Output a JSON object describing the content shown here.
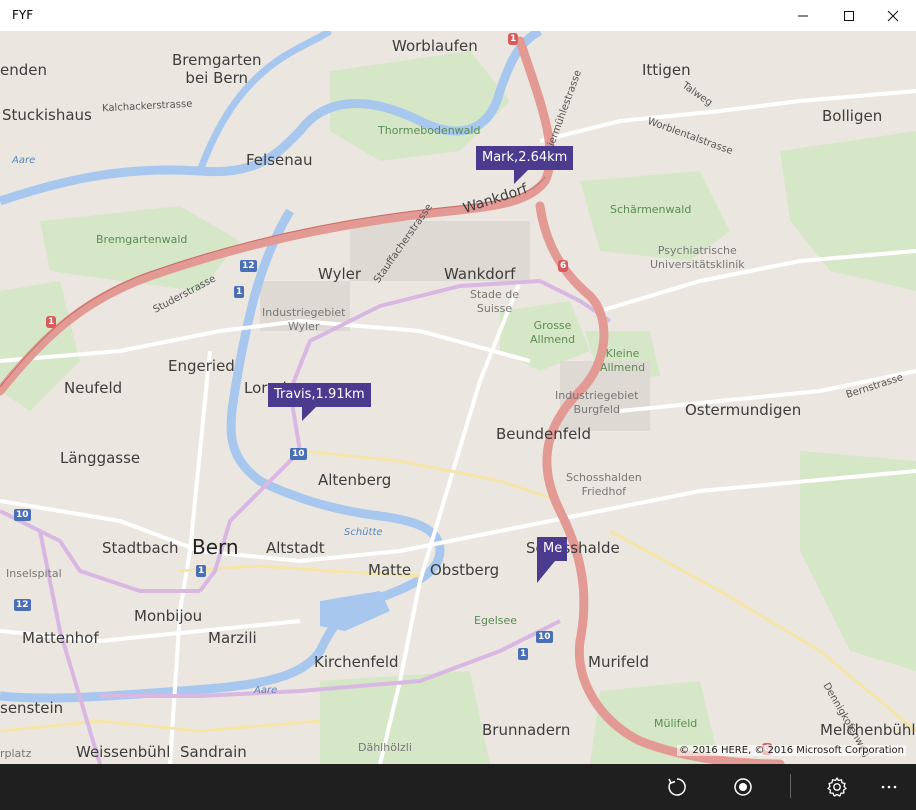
{
  "window": {
    "title": "FYF",
    "minimize_icon": "minimize-icon",
    "maximize_icon": "maximize-icon",
    "close_icon": "close-icon"
  },
  "map": {
    "labels": {
      "worblaufen": "Worblaufen",
      "ittigen": "Ittigen",
      "bremgarten": "Bremgarten\nbei Bern",
      "enden": "enden",
      "stuckishaus": "Stuckishaus",
      "kalchacker": "Kalchackerstrasse",
      "thormeboden": "Thormebodenwald",
      "felsenau": "Felsenau",
      "aare1": "Aare",
      "aare2": "Aare",
      "aare3": "Aare",
      "talweg": "Talweg",
      "worblental": "Worblentalstrasse",
      "papiermuehle": "Papiermühlestrasse",
      "bolligen": "Bolligen",
      "wankdorf_road": "Wankdorf",
      "schermenwald": "Schärmenwald",
      "psychiatrische": "Psychiatrische\nUniversitätsklinik",
      "bremgartenwald": "Bremgartenwald",
      "studerstrasse": "Studerstrasse",
      "stauffacher": "Stauffacherstrasse",
      "wyler": "Wyler",
      "wankdorf": "Wankdorf",
      "stade": "Stade de\nSuisse",
      "industrie_wyler": "Industriegebiet\nWyler",
      "grosse_allmend": "Grosse\nAllmend",
      "kleine_allmend": "Kleine\nAllmend",
      "engeried": "Engeried",
      "neufeld": "Neufeld",
      "lorraine": "Lorraine",
      "industrie_burgfeld": "Industriegebiet\nBurgfeld",
      "bernstrasse": "Bernstrasse",
      "ostermundigen": "Ostermundigen",
      "beundenfeld": "Beundenfeld",
      "laenggasse": "Länggasse",
      "altenberg": "Altenberg",
      "schosshalden_friedhof": "Schosshalden\nFriedhof",
      "schuette": "Schütte",
      "stadtbach": "Stadtbach",
      "bern": "Bern",
      "altstadt": "Altstadt",
      "schosshalde": "Schosshalde",
      "inselspital": "Inselspital",
      "matte": "Matte",
      "obstberg": "Obstberg",
      "monbijou": "Monbijou",
      "mattenhof": "Mattenhof",
      "marzili": "Marzili",
      "egelsee": "Egelsee",
      "muri": "Murifeld",
      "kirchenfeld": "Kirchenfeld",
      "dennigkofen": "Dennigkofenweg",
      "senstein": "senstein",
      "brunnadern": "Brunnadern",
      "melchenbuehl": "Melchenbühl",
      "weissenbuehl": "Weissenbühl",
      "sandrain": "Sandrain",
      "daehlhoelzli": "Dählhölzli",
      "muriholz": "Mülifeld",
      "platz": "rplatz"
    },
    "shields": {
      "r1_top": "1",
      "r1_left": "1",
      "r6": "6",
      "r6_low": "6",
      "b12_a": "12",
      "b1_a": "1",
      "b10_a": "10",
      "b10_b": "10",
      "b1_b": "1",
      "b12_b": "12",
      "b10_c": "10",
      "b1_c": "1"
    },
    "pins": {
      "mark": "Mark,2.64km",
      "travis": "Travis,1.91km",
      "me": "Me"
    },
    "copyright": "© 2016 HERE, © 2016 Microsoft Corporation",
    "colors": {
      "pin": "#4a3b8f",
      "motorway": "#e39a95",
      "river": "#a7c7ef",
      "forest": "#cde3bf",
      "tram": "#d9b7e3"
    }
  },
  "appbar": {
    "refresh_icon": "refresh-icon",
    "locate_icon": "locate-me-icon",
    "settings_icon": "settings-gear-icon",
    "more_icon": "more-ellipsis-icon"
  }
}
